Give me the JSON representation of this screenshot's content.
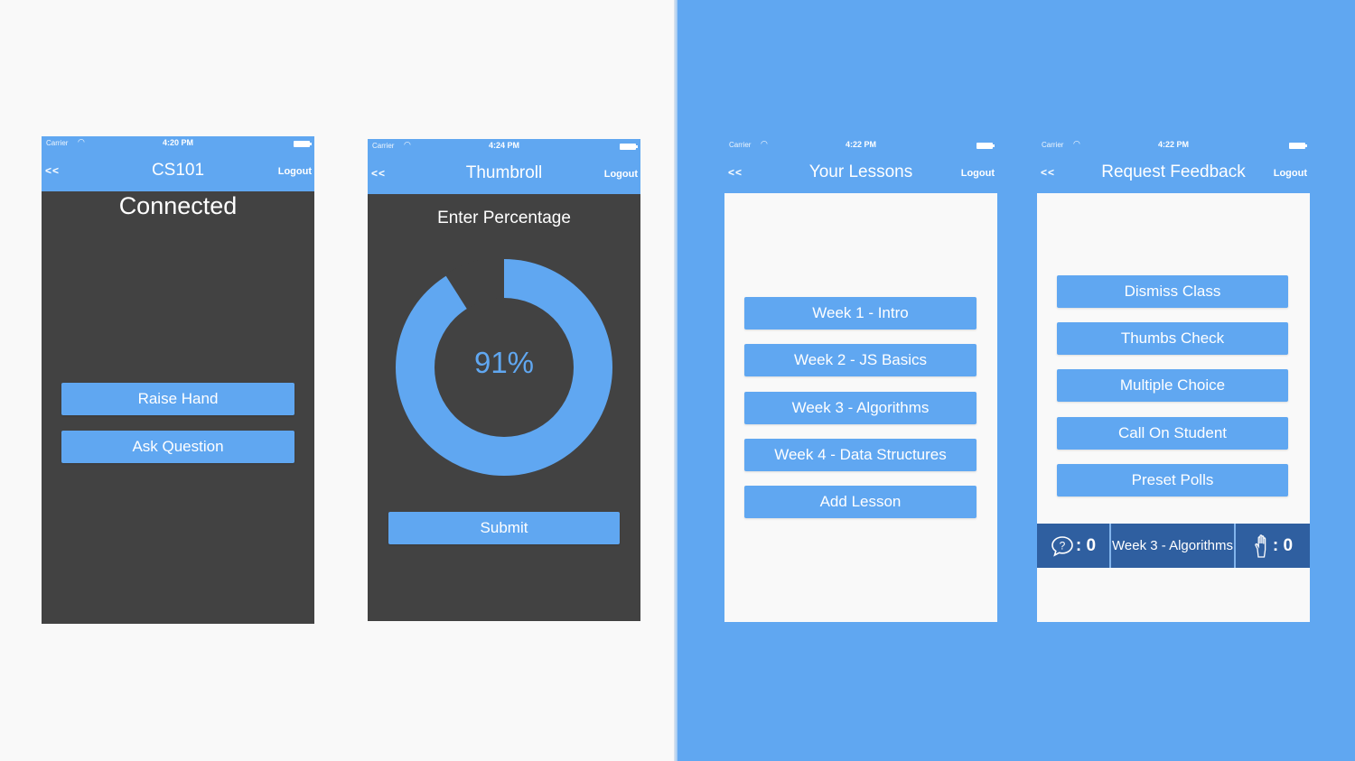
{
  "colors": {
    "accent": "#60a7f1",
    "dark_bg": "#424242",
    "light_bg": "#f9f9f9",
    "footer_bg": "#2f5fa0"
  },
  "status": {
    "carrier": "Carrier",
    "wifi_icon": "wifi-icon",
    "battery_icon": "battery-icon"
  },
  "screens": {
    "connected": {
      "time": "4:20 PM",
      "back": "<<",
      "title": "CS101",
      "logout": "Logout",
      "heading": "Connected",
      "buttons": [
        "Raise Hand",
        "Ask Question"
      ]
    },
    "thumbroll": {
      "time": "4:24 PM",
      "back": "<<",
      "title": "Thumbroll",
      "logout": "Logout",
      "heading": "Enter Percentage",
      "percentage": 91,
      "percentage_label": "91%",
      "submit": "Submit"
    },
    "lessons": {
      "time": "4:22 PM",
      "back": "<<",
      "title": "Your Lessons",
      "logout": "Logout",
      "items": [
        "Week 1 - Intro",
        "Week 2 - JS Basics",
        "Week 3 - Algorithms",
        "Week 4 - Data Structures",
        "Add Lesson"
      ]
    },
    "feedback": {
      "time": "4:22 PM",
      "back": "<<",
      "title": "Request Feedback",
      "logout": "Logout",
      "items": [
        "Dismiss Class",
        "Thumbs Check",
        "Multiple Choice",
        "Call On Student",
        "Preset Polls"
      ],
      "footer": {
        "question_icon": "question-bubble-icon",
        "questions": ": 0",
        "lesson": "Week 3 - Algorithms",
        "hand_icon": "raised-hand-icon",
        "hands": ": 0"
      }
    }
  }
}
